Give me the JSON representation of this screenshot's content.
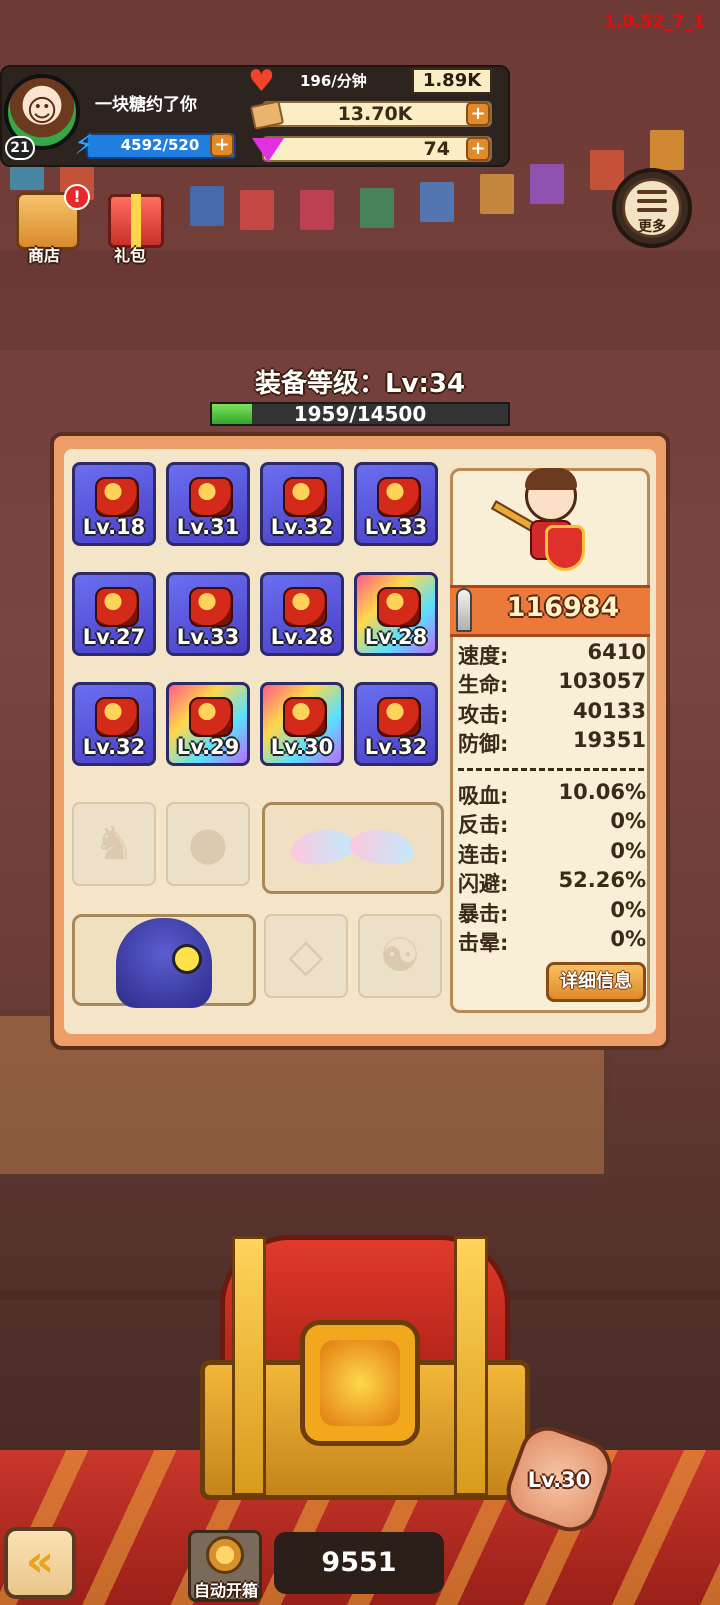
{
  "version": "1.0.52_7_1",
  "player": {
    "name": "一块糖约了你",
    "level": "21",
    "energy": "4592/520"
  },
  "resources": {
    "rate_label": "196/分钟",
    "rate_value": "1.89K",
    "cash": "13.70K",
    "gems": "74"
  },
  "top_icons": {
    "shop_label": "商店",
    "gift_label": "礼包",
    "more_label": "更多",
    "alert": "!"
  },
  "equipment": {
    "title": "装备等级：Lv:34",
    "exp_text": "1959/14500",
    "exp_fraction": 0.135,
    "slots": [
      {
        "lv": "Lv.18"
      },
      {
        "lv": "Lv.31"
      },
      {
        "lv": "Lv.32"
      },
      {
        "lv": "Lv.33"
      },
      {
        "lv": "Lv.27"
      },
      {
        "lv": "Lv.33"
      },
      {
        "lv": "Lv.28"
      },
      {
        "lv": "Lv.28"
      },
      {
        "lv": "Lv.32"
      },
      {
        "lv": "Lv.29"
      },
      {
        "lv": "Lv.30"
      },
      {
        "lv": "Lv.32"
      }
    ]
  },
  "stats": {
    "power": "116984",
    "base": [
      {
        "k": "速度:",
        "v": "6410"
      },
      {
        "k": "生命:",
        "v": "103057"
      },
      {
        "k": "攻击:",
        "v": "40133"
      },
      {
        "k": "防御:",
        "v": "19351"
      }
    ],
    "extra": [
      {
        "k": "吸血:",
        "v": "10.06%"
      },
      {
        "k": "反击:",
        "v": "0%"
      },
      {
        "k": "连击:",
        "v": "0%"
      },
      {
        "k": "闪避:",
        "v": "52.26%"
      },
      {
        "k": "暴击:",
        "v": "0%"
      },
      {
        "k": "击晕:",
        "v": "0%"
      }
    ],
    "detail_button": "详细信息"
  },
  "chest": {
    "level": "Lv.30",
    "count": "9551",
    "auto_label": "自动开箱"
  }
}
